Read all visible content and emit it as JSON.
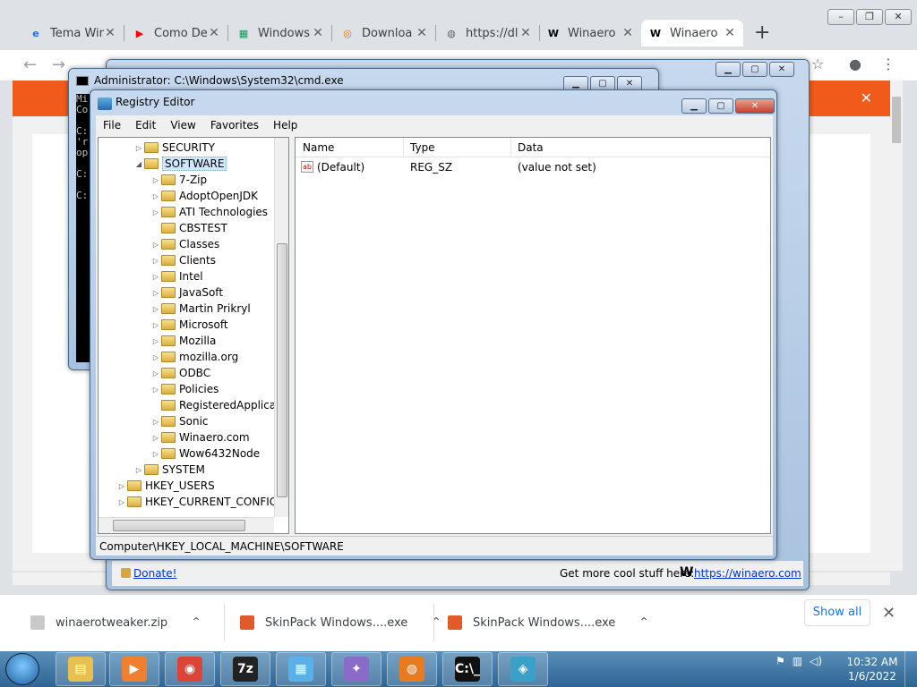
{
  "browser": {
    "tabs": [
      {
        "title": "Tema Win",
        "icon": "edge-icon",
        "color": "#1a73e8"
      },
      {
        "title": "Como De",
        "icon": "youtube-icon",
        "color": "#ff0000"
      },
      {
        "title": "Windows",
        "icon": "sheets-icon",
        "color": "#0f9d58"
      },
      {
        "title": "Downloa",
        "icon": "chrome-dl-icon",
        "color": "#e37400"
      },
      {
        "title": "https://dl",
        "icon": "globe-icon",
        "color": "#5f6368"
      },
      {
        "title": "Winaero",
        "icon": "winaero-icon",
        "color": "#000000"
      },
      {
        "title": "Winaero",
        "icon": "winaero-icon",
        "color": "#000000"
      }
    ],
    "new_tab": "+",
    "window_buttons": {
      "min": "–",
      "max": "❐",
      "close": "✕"
    },
    "nav": {
      "back": "←",
      "forward": "→",
      "star": "☆",
      "profile": "●",
      "menu": "⋮"
    },
    "banner_close": "✕",
    "accent": "#f05a1a"
  },
  "cmd": {
    "title": "Administrator: C:\\Windows\\System32\\cmd.exe",
    "lines": [
      "Mi",
      "Co",
      "",
      "C:",
      "'r",
      "op",
      "",
      "C:",
      "",
      "C:"
    ]
  },
  "registry": {
    "title": "Registry Editor",
    "menu": [
      "File",
      "Edit",
      "View",
      "Favorites",
      "Help"
    ],
    "tree": [
      {
        "label": "SECURITY",
        "level": 2,
        "expander": "▷"
      },
      {
        "label": "SOFTWARE",
        "level": 2,
        "expander": "◢",
        "selected": true
      },
      {
        "label": "7-Zip",
        "level": 3,
        "expander": "▷"
      },
      {
        "label": "AdoptOpenJDK",
        "level": 3,
        "expander": "▷"
      },
      {
        "label": "ATI Technologies",
        "level": 3,
        "expander": "▷"
      },
      {
        "label": "CBSTEST",
        "level": 3,
        "expander": ""
      },
      {
        "label": "Classes",
        "level": 3,
        "expander": "▷"
      },
      {
        "label": "Clients",
        "level": 3,
        "expander": "▷"
      },
      {
        "label": "Intel",
        "level": 3,
        "expander": "▷"
      },
      {
        "label": "JavaSoft",
        "level": 3,
        "expander": "▷"
      },
      {
        "label": "Martin Prikryl",
        "level": 3,
        "expander": "▷"
      },
      {
        "label": "Microsoft",
        "level": 3,
        "expander": "▷"
      },
      {
        "label": "Mozilla",
        "level": 3,
        "expander": "▷"
      },
      {
        "label": "mozilla.org",
        "level": 3,
        "expander": "▷"
      },
      {
        "label": "ODBC",
        "level": 3,
        "expander": "▷"
      },
      {
        "label": "Policies",
        "level": 3,
        "expander": "▷"
      },
      {
        "label": "RegisteredApplica",
        "level": 3,
        "expander": ""
      },
      {
        "label": "Sonic",
        "level": 3,
        "expander": "▷"
      },
      {
        "label": "Winaero.com",
        "level": 3,
        "expander": "▷"
      },
      {
        "label": "Wow6432Node",
        "level": 3,
        "expander": "▷"
      },
      {
        "label": "SYSTEM",
        "level": 2,
        "expander": "▷"
      },
      {
        "label": "HKEY_USERS",
        "level": 1,
        "expander": "▷"
      },
      {
        "label": "HKEY_CURRENT_CONFIG",
        "level": 1,
        "expander": "▷"
      }
    ],
    "columns": {
      "name": "Name",
      "type": "Type",
      "data": "Data"
    },
    "values": [
      {
        "name": "(Default)",
        "type": "REG_SZ",
        "data": "(value not set)"
      }
    ],
    "status": "Computer\\HKEY_LOCAL_MACHINE\\SOFTWARE"
  },
  "tweaker": {
    "donate": "Donate!",
    "more": "Get more cool stuff here:",
    "link": "https://winaero.com",
    "logo": "W"
  },
  "downloads": {
    "items": [
      {
        "name": "winaerotweaker.zip",
        "color": "#c9c9c9"
      },
      {
        "name": "SkinPack Windows....exe",
        "color": "#e05a2a"
      },
      {
        "name": "SkinPack Windows....exe",
        "color": "#e05a2a"
      }
    ],
    "show_all": "Show all",
    "close": "✕"
  },
  "taskbar": {
    "apps": [
      {
        "name": "explorer",
        "glyph": "▤",
        "color": "#e8c050"
      },
      {
        "name": "media",
        "glyph": "▶",
        "color": "#f08030"
      },
      {
        "name": "chrome",
        "glyph": "◉",
        "color": "#db4437"
      },
      {
        "name": "7zip",
        "glyph": "7z",
        "color": "#222222"
      },
      {
        "name": "control",
        "glyph": "▦",
        "color": "#5ab0e8"
      },
      {
        "name": "tweaker",
        "glyph": "✦",
        "color": "#8a6cc8"
      },
      {
        "name": "firefox",
        "glyph": "◍",
        "color": "#e87a20"
      },
      {
        "name": "cmd",
        "glyph": "C:\\_",
        "color": "#111111"
      },
      {
        "name": "regedit",
        "glyph": "◈",
        "color": "#3aa0c8"
      }
    ],
    "time": "10:32 AM",
    "date": "1/6/2022"
  }
}
